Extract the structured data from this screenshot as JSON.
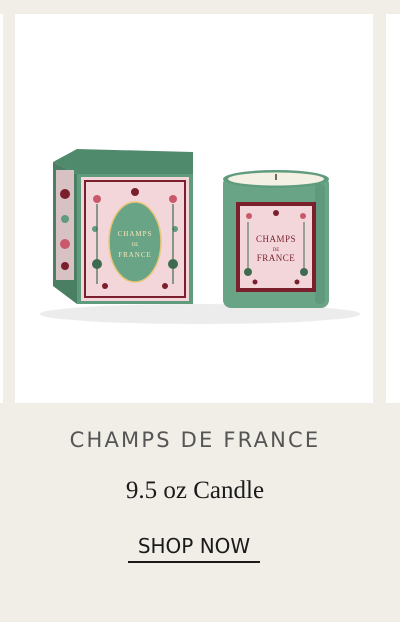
{
  "product": {
    "collection_name": "CHAMPS DE FRANCE",
    "description": "9.5 oz Candle",
    "cta_label": "SHOP NOW",
    "image": {
      "box_label_line1": "CHAMPS",
      "box_label_line2": "DE",
      "box_label_line3": "FRANCE",
      "jar_label_line1": "CHAMPS",
      "jar_label_line2": "DE",
      "jar_label_line3": "FRANCE"
    }
  },
  "colors": {
    "page_background": "#f1ede7",
    "image_background": "#ffffff",
    "box_green": "#5f9b7d",
    "label_burgundy": "#7a1f2c",
    "label_pink": "#f3d6da",
    "jar_green": "#6aa487",
    "text_gray": "#555555",
    "text_dark": "#1b1b1b"
  }
}
